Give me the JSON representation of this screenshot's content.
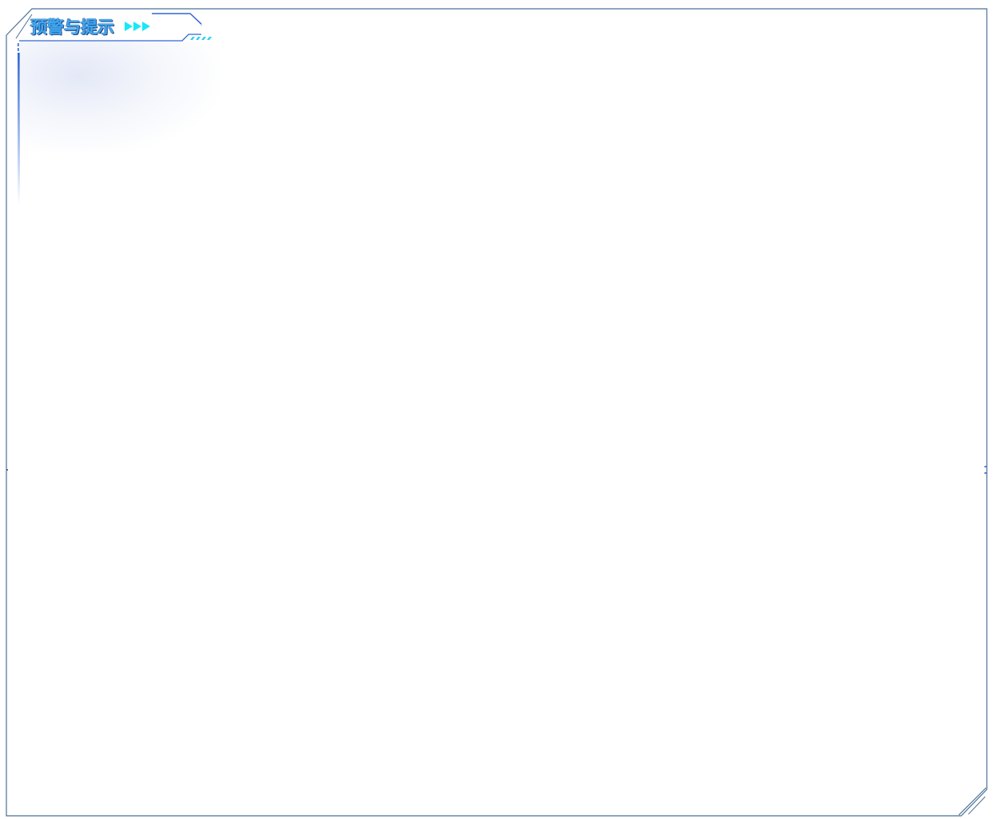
{
  "panel": {
    "title": "预警与提示"
  },
  "icons": {
    "title_arrows": "triple-chevron-right-icon"
  },
  "colors": {
    "frame": "#4a6f96",
    "accent_blue": "#2f66d4",
    "title_text": "#3fa8ee",
    "arrow": "#19e8f5",
    "stripe": "#29d0f2"
  }
}
